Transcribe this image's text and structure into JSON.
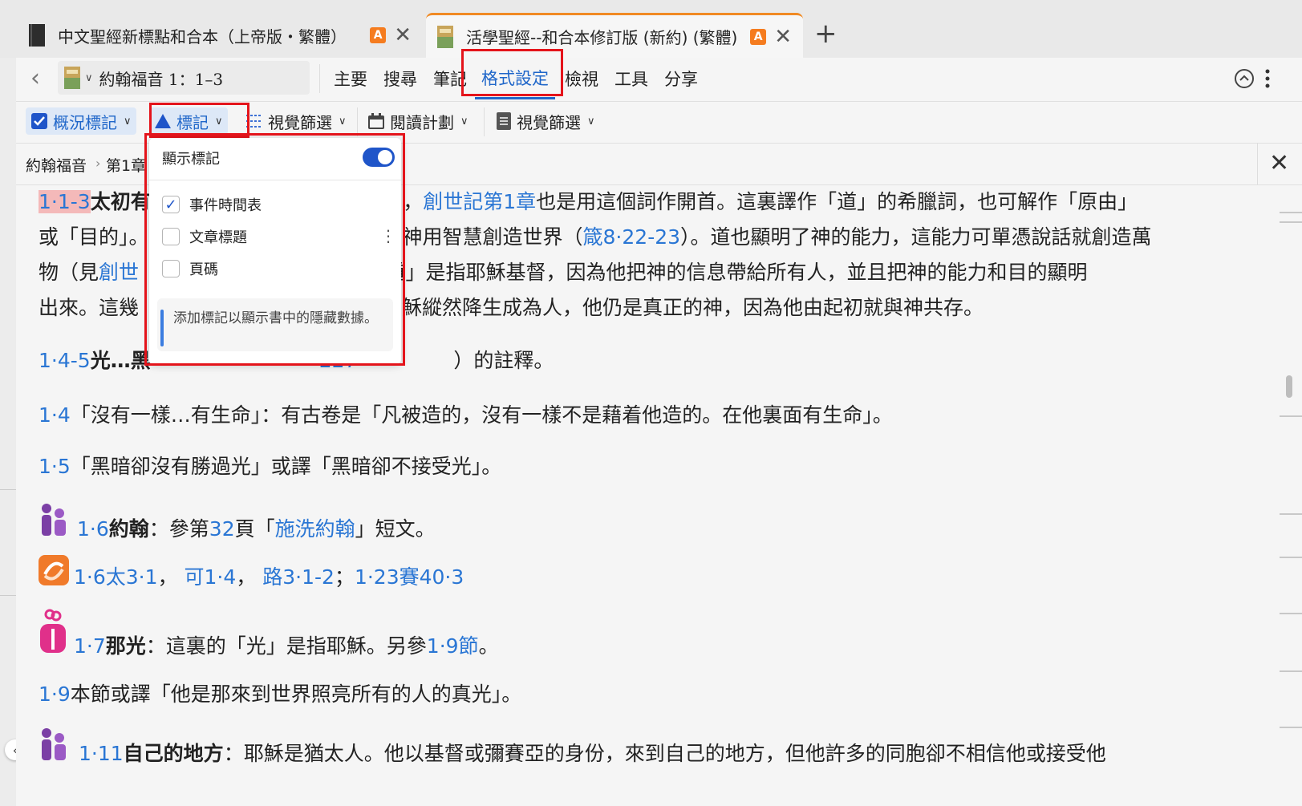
{
  "tabs": [
    {
      "title": "中文聖經新標點和合本（上帝版・繁體）",
      "badge": "A",
      "close": "✕"
    },
    {
      "title": "活學聖經--和合本修訂版 (新約) (繁體)",
      "badge": "A",
      "close": "✕",
      "active": true
    }
  ],
  "new_tab": "+",
  "toolbar": {
    "back": "‹",
    "reference": "約翰福音 1：1–3",
    "menus": [
      "主要",
      "搜尋",
      "筆記",
      "格式設定",
      "檢視",
      "工具",
      "分享"
    ],
    "active_menu": "格式設定"
  },
  "subtoolbar": {
    "items": [
      {
        "label": "概況標記",
        "icon": "checkbox-icon"
      },
      {
        "label": "標記",
        "icon": "triangle-icon"
      },
      {
        "label": "視覺篩選",
        "icon": "filter-icon"
      },
      {
        "label": "閱讀計劃",
        "icon": "calendar-icon"
      },
      {
        "label": "視覺篩選",
        "icon": "document-icon"
      }
    ]
  },
  "breadcrumb": {
    "book": "約翰福音",
    "sep": "›",
    "chapter": "第1章",
    "close": "✕"
  },
  "dropdown": {
    "header": "顯示標記",
    "toggle_on": true,
    "items": [
      {
        "label": "事件時間表",
        "checked": true,
        "check": "✓"
      },
      {
        "label": "文章標題",
        "checked": false
      },
      {
        "label": "頁碼",
        "checked": false
      }
    ],
    "more": "⋮",
    "info": "添加標記以顯示書中的隱藏數據。"
  },
  "content": {
    "p1": {
      "ref": "1·1-3",
      "bold": "太初有",
      "l1a": "起初」，",
      "l1link": "創世記第1章",
      "l1b": "也是用這個詞作開首。這裏譯作「道」的希臘詞，也可解作「原由」",
      "l2a": "或「目的」。",
      "l2b": "神用智慧創造世界（",
      "l2link": "箴8·22-23",
      "l2c": "）。道也顯明了神的能力，這能力可單憑說話就創造萬",
      "l3a": "物（見",
      "l3link": "創世",
      "l3b": "，「道」是指耶穌基督，因為他把神的信息帶給所有人，並且把神的能力和目的顯明",
      "l4a": "出來。這幾",
      "l4b": "穌縱然降生成為人，他仍是真正的神，因為他由起初就與神共存。"
    },
    "p2": {
      "ref": "1·4-5",
      "bold": "光…黑",
      "link": "227",
      "text": "）的註釋。"
    },
    "p3": {
      "ref": "1·4",
      "text": "「沒有一樣…有生命」：有古卷是「凡被造的，沒有一樣不是藉着他造的。在他裏面有生命」。"
    },
    "p4": {
      "ref": "1·5",
      "text": "「黑暗卻沒有勝過光」或譯「黑暗卻不接受光」。"
    },
    "p5": {
      "ref": "1·6",
      "bold": "約翰",
      "a": "：參第",
      "page": "32",
      "b": "頁「",
      "link": "施洗約翰",
      "c": "」短文。"
    },
    "p6": {
      "ref": "1·6",
      "links": [
        "太3·1",
        "可1·4",
        "路3·1-2"
      ],
      "sep": "，",
      "semi": "；",
      "ref2": "1·23",
      "link2": "賽40·3"
    },
    "p7": {
      "ref": "1·7",
      "bold": "那光",
      "a": "：這裏的「光」是指耶穌。另參",
      "link": "1·9節",
      "b": "。"
    },
    "p8": {
      "ref": "1·9",
      "text": "本節或譯「他是那來到世界照亮所有的人的真光」。"
    },
    "p9": {
      "ref": "1·11",
      "bold": "自己的地方",
      "text": "：耶穌是猶太人。他以基督或彌賽亞的身份，來到自己的地方，但他許多的同胞卻不相信他或接受他"
    }
  },
  "colors": {
    "accent": "#1f66c9",
    "link": "#2a76d4",
    "highlight": "#f4b9b9",
    "red_outline": "#e4141b",
    "badge": "#f57c1f"
  }
}
